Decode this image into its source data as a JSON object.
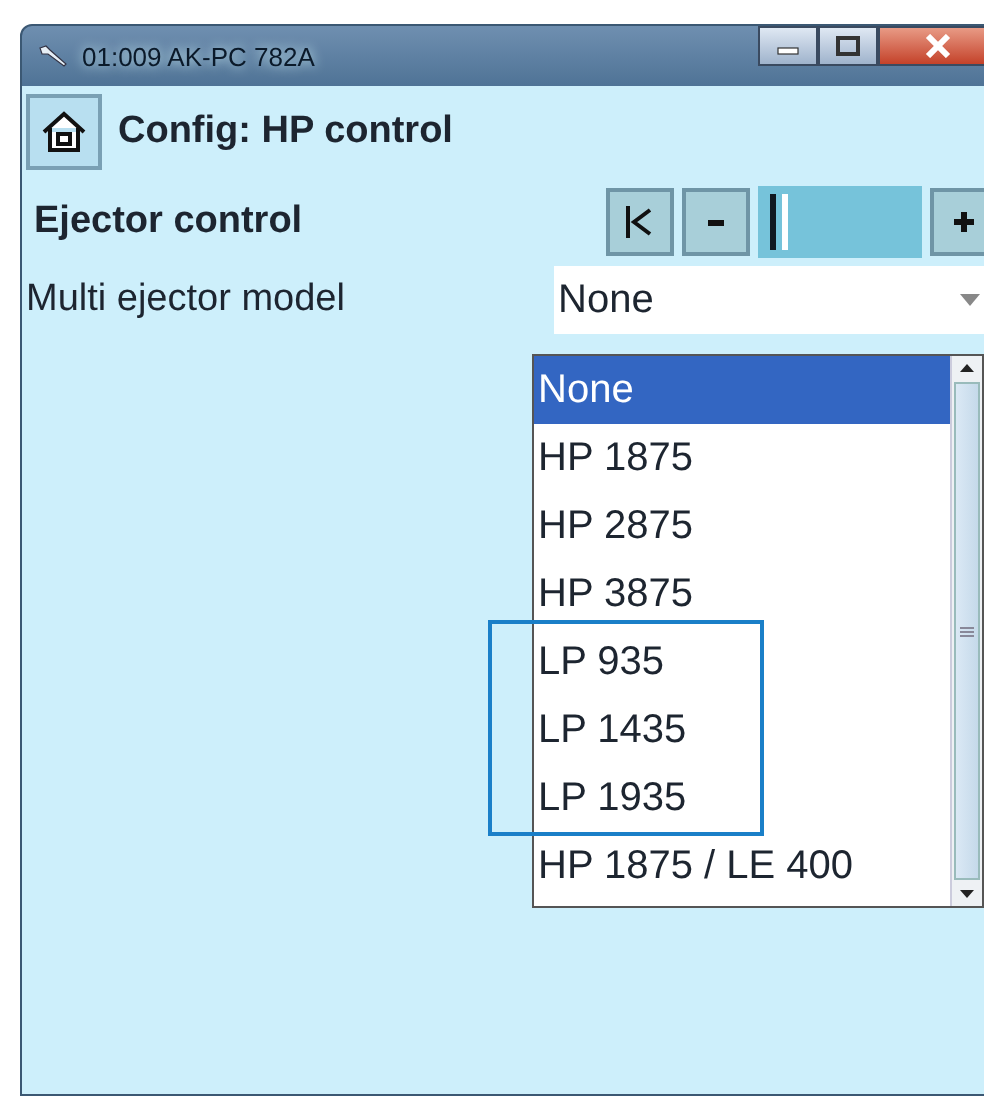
{
  "window": {
    "title": "01:009 AK-PC 782A"
  },
  "header": {
    "title": "Config: HP control"
  },
  "ejector_control": {
    "label": "Ejector control"
  },
  "multi_ejector_model": {
    "label": "Multi ejector model",
    "value": "None",
    "options": [
      {
        "label": "None",
        "selected": true,
        "outlined": false
      },
      {
        "label": "HP 1875",
        "selected": false,
        "outlined": false
      },
      {
        "label": "HP 2875",
        "selected": false,
        "outlined": false
      },
      {
        "label": "HP 3875",
        "selected": false,
        "outlined": false
      },
      {
        "label": "LP 935",
        "selected": false,
        "outlined": true
      },
      {
        "label": "LP 1435",
        "selected": false,
        "outlined": true
      },
      {
        "label": "LP 1935",
        "selected": false,
        "outlined": true
      },
      {
        "label": "HP 1875 / LE 400",
        "selected": false,
        "outlined": false
      }
    ]
  }
}
